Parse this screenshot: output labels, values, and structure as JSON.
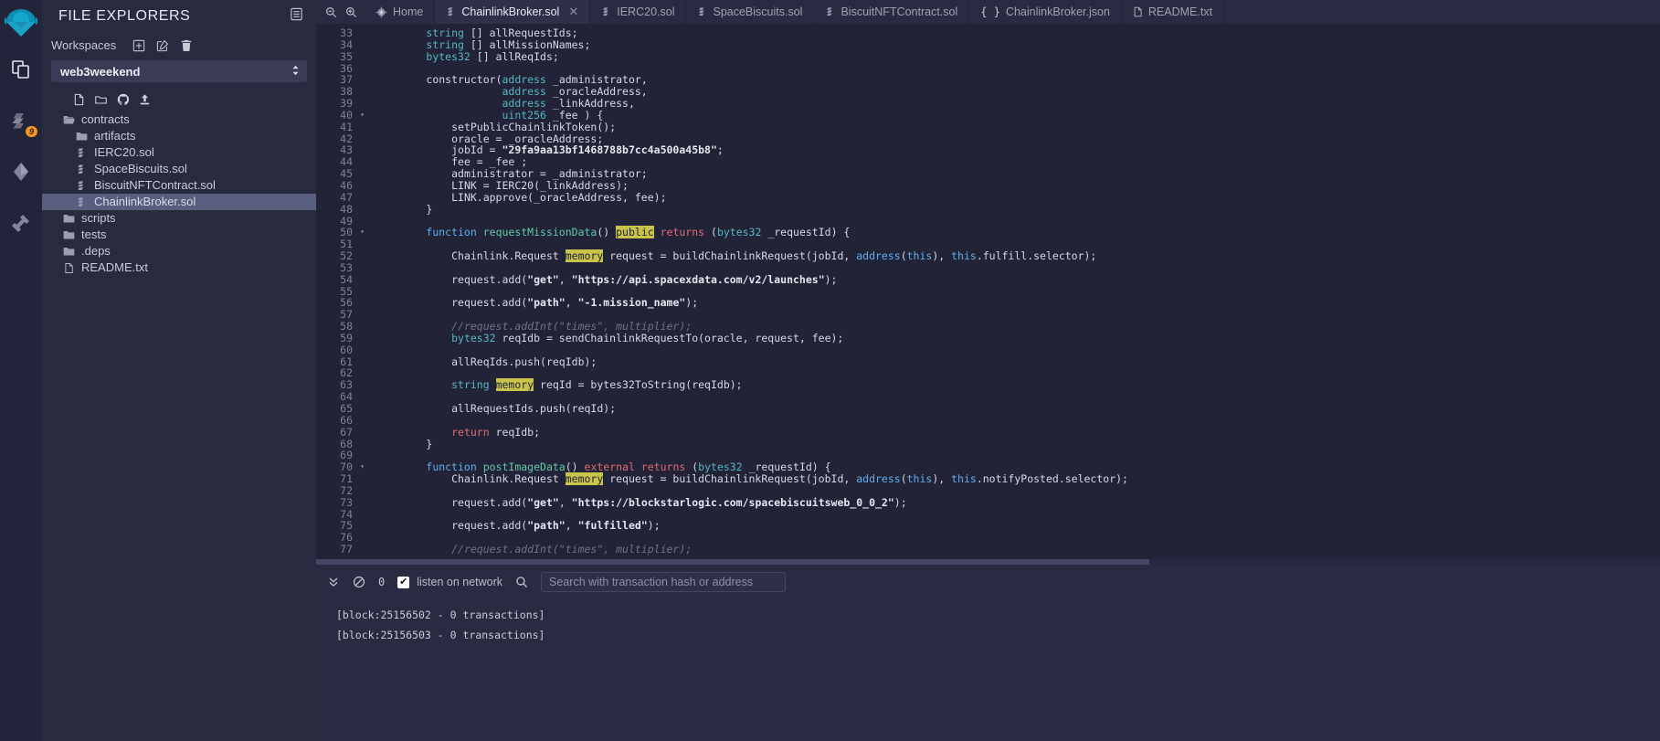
{
  "rail": {
    "logo": "remix-logo-icon",
    "items": [
      {
        "name": "file-explorers",
        "icon": "files-icon",
        "badge": null
      },
      {
        "name": "solidity-compiler",
        "icon": "solidity-compiler-icon",
        "badge": "9"
      },
      {
        "name": "deploy-and-run",
        "icon": "deploy-run-icon",
        "badge": null
      },
      {
        "name": "plugin-manager",
        "icon": "plugin-plug-icon",
        "badge": null
      }
    ]
  },
  "explorer": {
    "title": "FILE EXPLORERS",
    "header_icon": "panel-toggle-icon",
    "workspaces_label": "Workspaces",
    "workspace_actions": [
      {
        "name": "create-workspace",
        "icon": "plus-square-icon"
      },
      {
        "name": "rename-workspace",
        "icon": "pencil-square-icon"
      },
      {
        "name": "delete-workspace",
        "icon": "trash-icon"
      }
    ],
    "selected_workspace": "web3weekend",
    "tree_actions": [
      {
        "name": "new-file",
        "icon": "new-file-icon"
      },
      {
        "name": "new-folder",
        "icon": "new-folder-icon"
      },
      {
        "name": "connect-github",
        "icon": "github-icon"
      },
      {
        "name": "publish-to-gist",
        "icon": "upload-icon"
      }
    ],
    "tree": [
      {
        "label": "contracts",
        "type": "folder-open",
        "depth": 0,
        "selected": false
      },
      {
        "label": "artifacts",
        "type": "folder",
        "depth": 1,
        "selected": false
      },
      {
        "label": "IERC20.sol",
        "type": "solidity",
        "depth": 1,
        "selected": false
      },
      {
        "label": "SpaceBiscuits.sol",
        "type": "solidity",
        "depth": 1,
        "selected": false
      },
      {
        "label": "BiscuitNFTContract.sol",
        "type": "solidity",
        "depth": 1,
        "selected": false
      },
      {
        "label": "ChainlinkBroker.sol",
        "type": "solidity",
        "depth": 1,
        "selected": true
      },
      {
        "label": "scripts",
        "type": "folder",
        "depth": 0,
        "selected": false
      },
      {
        "label": "tests",
        "type": "folder",
        "depth": 0,
        "selected": false
      },
      {
        "label": ".deps",
        "type": "folder",
        "depth": 0,
        "selected": false
      },
      {
        "label": "README.txt",
        "type": "text",
        "depth": 0,
        "selected": false
      }
    ]
  },
  "tabbar": {
    "zoom_out": "zoom-out-icon",
    "zoom_in": "zoom-in-icon",
    "home_icon": "remix-home-icon",
    "tabs": [
      {
        "label": "Home",
        "icon": "remix-home-icon",
        "active": false,
        "closable": false
      },
      {
        "label": "ChainlinkBroker.sol",
        "icon": "solidity-icon",
        "active": true,
        "closable": true
      },
      {
        "label": "IERC20.sol",
        "icon": "solidity-icon",
        "active": false,
        "closable": false
      },
      {
        "label": "SpaceBiscuits.sol",
        "icon": "solidity-icon",
        "active": false,
        "closable": false
      },
      {
        "label": "BiscuitNFTContract.sol",
        "icon": "solidity-icon",
        "active": false,
        "closable": false
      },
      {
        "label": "ChainlinkBroker.json",
        "icon": "json-icon",
        "active": false,
        "closable": false
      },
      {
        "label": "README.txt",
        "icon": "text-file-icon",
        "active": false,
        "closable": false
      }
    ]
  },
  "editor": {
    "first_line": 33,
    "lines": [
      {
        "n": 33,
        "fold": false,
        "tokens": [
          {
            "t": "        ",
            "c": "ind"
          },
          {
            "t": "string",
            "c": "k2"
          },
          {
            "t": " [] allRequestIds;",
            "c": "wh"
          }
        ]
      },
      {
        "n": 34,
        "fold": false,
        "tokens": [
          {
            "t": "        ",
            "c": "ind"
          },
          {
            "t": "string",
            "c": "k2"
          },
          {
            "t": " [] allMissionNames;",
            "c": "wh"
          }
        ]
      },
      {
        "n": 35,
        "fold": false,
        "tokens": [
          {
            "t": "        ",
            "c": "ind"
          },
          {
            "t": "bytes32",
            "c": "k2"
          },
          {
            "t": " [] allReqIds;",
            "c": "wh"
          }
        ]
      },
      {
        "n": 36,
        "fold": false,
        "tokens": []
      },
      {
        "n": 37,
        "fold": false,
        "tokens": [
          {
            "t": "        ",
            "c": "ind"
          },
          {
            "t": "constructor",
            "c": "wh"
          },
          {
            "t": "(",
            "c": "wh"
          },
          {
            "t": "address",
            "c": "k2"
          },
          {
            "t": " _administrator,",
            "c": "wh"
          }
        ]
      },
      {
        "n": 38,
        "fold": false,
        "tokens": [
          {
            "t": "                    ",
            "c": "ind"
          },
          {
            "t": "address",
            "c": "k2"
          },
          {
            "t": " _oracleAddress,",
            "c": "wh"
          }
        ]
      },
      {
        "n": 39,
        "fold": false,
        "tokens": [
          {
            "t": "                    ",
            "c": "ind"
          },
          {
            "t": "address",
            "c": "k2"
          },
          {
            "t": " _linkAddress,",
            "c": "wh"
          }
        ]
      },
      {
        "n": 40,
        "fold": true,
        "tokens": [
          {
            "t": "                    ",
            "c": "ind"
          },
          {
            "t": "uint256",
            "c": "k2"
          },
          {
            "t": " _fee ) {",
            "c": "wh"
          }
        ]
      },
      {
        "n": 41,
        "fold": false,
        "tokens": [
          {
            "t": "            ",
            "c": "ind"
          },
          {
            "t": "setPublicChainlinkToken();",
            "c": "wh"
          }
        ]
      },
      {
        "n": 42,
        "fold": false,
        "tokens": [
          {
            "t": "            ",
            "c": "ind"
          },
          {
            "t": "oracle = _oracleAddress;",
            "c": "wh"
          }
        ]
      },
      {
        "n": 43,
        "fold": false,
        "tokens": [
          {
            "t": "            ",
            "c": "ind"
          },
          {
            "t": "jobId = ",
            "c": "wh"
          },
          {
            "t": "\"29fa9aa13bf1468788b7cc4a500a45b8\"",
            "c": "s"
          },
          {
            "t": ";",
            "c": "wh"
          }
        ]
      },
      {
        "n": 44,
        "fold": false,
        "tokens": [
          {
            "t": "            ",
            "c": "ind"
          },
          {
            "t": "fee = _fee ;",
            "c": "wh"
          }
        ]
      },
      {
        "n": 45,
        "fold": false,
        "tokens": [
          {
            "t": "            ",
            "c": "ind"
          },
          {
            "t": "administrator = _administrator;",
            "c": "wh"
          }
        ]
      },
      {
        "n": 46,
        "fold": false,
        "tokens": [
          {
            "t": "            ",
            "c": "ind"
          },
          {
            "t": "LINK = IERC20(_linkAddress);",
            "c": "wh"
          }
        ]
      },
      {
        "n": 47,
        "fold": false,
        "tokens": [
          {
            "t": "            ",
            "c": "ind"
          },
          {
            "t": "LINK.approve(_oracleAddress, fee);",
            "c": "wh"
          }
        ]
      },
      {
        "n": 48,
        "fold": false,
        "tokens": [
          {
            "t": "        ",
            "c": "ind"
          },
          {
            "t": "}",
            "c": "wh"
          }
        ]
      },
      {
        "n": 49,
        "fold": false,
        "tokens": []
      },
      {
        "n": 50,
        "fold": true,
        "tokens": [
          {
            "t": "        ",
            "c": "ind"
          },
          {
            "t": "function",
            "c": "bl"
          },
          {
            "t": " ",
            "c": "wh"
          },
          {
            "t": "requestMissionData",
            "c": "fn"
          },
          {
            "t": "() ",
            "c": "wh"
          },
          {
            "t": "public",
            "c": "hl"
          },
          {
            "t": " ",
            "c": "wh"
          },
          {
            "t": "returns",
            "c": "k"
          },
          {
            "t": " (",
            "c": "wh"
          },
          {
            "t": "bytes32",
            "c": "k2"
          },
          {
            "t": " _requestId) {",
            "c": "wh"
          }
        ]
      },
      {
        "n": 51,
        "fold": false,
        "tokens": []
      },
      {
        "n": 52,
        "fold": false,
        "tokens": [
          {
            "t": "            ",
            "c": "ind"
          },
          {
            "t": "Chainlink.Request ",
            "c": "wh"
          },
          {
            "t": "memory",
            "c": "hl"
          },
          {
            "t": " request = buildChainlinkRequest(jobId, ",
            "c": "wh"
          },
          {
            "t": "address",
            "c": "bl"
          },
          {
            "t": "(",
            "c": "wh"
          },
          {
            "t": "this",
            "c": "bl"
          },
          {
            "t": "), ",
            "c": "wh"
          },
          {
            "t": "this",
            "c": "bl"
          },
          {
            "t": ".fulfill.selector);",
            "c": "wh"
          }
        ]
      },
      {
        "n": 53,
        "fold": false,
        "tokens": []
      },
      {
        "n": 54,
        "fold": false,
        "tokens": [
          {
            "t": "            ",
            "c": "ind"
          },
          {
            "t": "request.add(",
            "c": "wh"
          },
          {
            "t": "\"get\"",
            "c": "s"
          },
          {
            "t": ", ",
            "c": "wh"
          },
          {
            "t": "\"https://api.spacexdata.com/v2/launches\"",
            "c": "s"
          },
          {
            "t": ");",
            "c": "wh"
          }
        ]
      },
      {
        "n": 55,
        "fold": false,
        "tokens": []
      },
      {
        "n": 56,
        "fold": false,
        "tokens": [
          {
            "t": "            ",
            "c": "ind"
          },
          {
            "t": "request.add(",
            "c": "wh"
          },
          {
            "t": "\"path\"",
            "c": "s"
          },
          {
            "t": ", ",
            "c": "wh"
          },
          {
            "t": "\"-1.mission_name\"",
            "c": "s"
          },
          {
            "t": ");",
            "c": "wh"
          }
        ]
      },
      {
        "n": 57,
        "fold": false,
        "tokens": []
      },
      {
        "n": 58,
        "fold": false,
        "tokens": [
          {
            "t": "            ",
            "c": "ind"
          },
          {
            "t": "//request.addInt(\"times\", multiplier);",
            "c": "c"
          }
        ]
      },
      {
        "n": 59,
        "fold": false,
        "tokens": [
          {
            "t": "            ",
            "c": "ind"
          },
          {
            "t": "bytes32",
            "c": "k2"
          },
          {
            "t": " reqIdb = sendChainlinkRequestTo(oracle, request, fee);",
            "c": "wh"
          }
        ]
      },
      {
        "n": 60,
        "fold": false,
        "tokens": []
      },
      {
        "n": 61,
        "fold": false,
        "tokens": [
          {
            "t": "            ",
            "c": "ind"
          },
          {
            "t": "allReqIds.push(reqIdb);",
            "c": "wh"
          }
        ]
      },
      {
        "n": 62,
        "fold": false,
        "tokens": []
      },
      {
        "n": 63,
        "fold": false,
        "tokens": [
          {
            "t": "            ",
            "c": "ind"
          },
          {
            "t": "string",
            "c": "k2"
          },
          {
            "t": " ",
            "c": "wh"
          },
          {
            "t": "memory",
            "c": "hl"
          },
          {
            "t": " reqId = bytes32ToString(reqIdb);",
            "c": "wh"
          }
        ]
      },
      {
        "n": 64,
        "fold": false,
        "tokens": []
      },
      {
        "n": 65,
        "fold": false,
        "tokens": [
          {
            "t": "            ",
            "c": "ind"
          },
          {
            "t": "allRequestIds.push(reqId);",
            "c": "wh"
          }
        ]
      },
      {
        "n": 66,
        "fold": false,
        "tokens": []
      },
      {
        "n": 67,
        "fold": false,
        "tokens": [
          {
            "t": "            ",
            "c": "ind"
          },
          {
            "t": "return",
            "c": "k"
          },
          {
            "t": " reqIdb;",
            "c": "wh"
          }
        ]
      },
      {
        "n": 68,
        "fold": false,
        "tokens": [
          {
            "t": "        ",
            "c": "ind"
          },
          {
            "t": "}",
            "c": "wh"
          }
        ]
      },
      {
        "n": 69,
        "fold": false,
        "tokens": []
      },
      {
        "n": 70,
        "fold": true,
        "tokens": [
          {
            "t": "        ",
            "c": "ind"
          },
          {
            "t": "function",
            "c": "bl"
          },
          {
            "t": " ",
            "c": "wh"
          },
          {
            "t": "postImageData",
            "c": "fn"
          },
          {
            "t": "() ",
            "c": "wh"
          },
          {
            "t": "external",
            "c": "k"
          },
          {
            "t": " ",
            "c": "wh"
          },
          {
            "t": "returns",
            "c": "k"
          },
          {
            "t": " (",
            "c": "wh"
          },
          {
            "t": "bytes32",
            "c": "k2"
          },
          {
            "t": " _requestId) {",
            "c": "wh"
          }
        ]
      },
      {
        "n": 71,
        "fold": false,
        "tokens": [
          {
            "t": "            ",
            "c": "ind"
          },
          {
            "t": "Chainlink.Request ",
            "c": "wh"
          },
          {
            "t": "memory",
            "c": "hl"
          },
          {
            "t": " request = buildChainlinkRequest(jobId, ",
            "c": "wh"
          },
          {
            "t": "address",
            "c": "bl"
          },
          {
            "t": "(",
            "c": "wh"
          },
          {
            "t": "this",
            "c": "bl"
          },
          {
            "t": "), ",
            "c": "wh"
          },
          {
            "t": "this",
            "c": "bl"
          },
          {
            "t": ".notifyPosted.selector);",
            "c": "wh"
          }
        ]
      },
      {
        "n": 72,
        "fold": false,
        "tokens": []
      },
      {
        "n": 73,
        "fold": false,
        "tokens": [
          {
            "t": "            ",
            "c": "ind"
          },
          {
            "t": "request.add(",
            "c": "wh"
          },
          {
            "t": "\"get\"",
            "c": "s"
          },
          {
            "t": ", ",
            "c": "wh"
          },
          {
            "t": "\"https://blockstarlogic.com/spacebiscuitsweb_0_0_2\"",
            "c": "s"
          },
          {
            "t": ");",
            "c": "wh"
          }
        ]
      },
      {
        "n": 74,
        "fold": false,
        "tokens": []
      },
      {
        "n": 75,
        "fold": false,
        "tokens": [
          {
            "t": "            ",
            "c": "ind"
          },
          {
            "t": "request.add(",
            "c": "wh"
          },
          {
            "t": "\"path\"",
            "c": "s"
          },
          {
            "t": ", ",
            "c": "wh"
          },
          {
            "t": "\"fulfilled\"",
            "c": "s"
          },
          {
            "t": ");",
            "c": "wh"
          }
        ]
      },
      {
        "n": 76,
        "fold": false,
        "tokens": []
      },
      {
        "n": 77,
        "fold": false,
        "tokens": [
          {
            "t": "            ",
            "c": "ind"
          },
          {
            "t": "//request.addInt(\"times\", multiplier);",
            "c": "c"
          }
        ]
      }
    ]
  },
  "terminal": {
    "toggle_icon": "chevrons-down-icon",
    "clear_icon": "ban-clear-icon",
    "pending_count": "0",
    "listen_label": "listen on network",
    "listen_checked": true,
    "search_icon": "search-icon",
    "search_placeholder": "Search with transaction hash or address",
    "search_value": "",
    "log": [
      "[block:25156502 - 0 transactions]",
      "[block:25156503 - 0 transactions]"
    ]
  },
  "colors": {
    "accent": "#f7941e",
    "panel": "#282a3e",
    "editor_bg": "#222336",
    "selection": "#595d7e",
    "highlight": "#c8c44a"
  }
}
